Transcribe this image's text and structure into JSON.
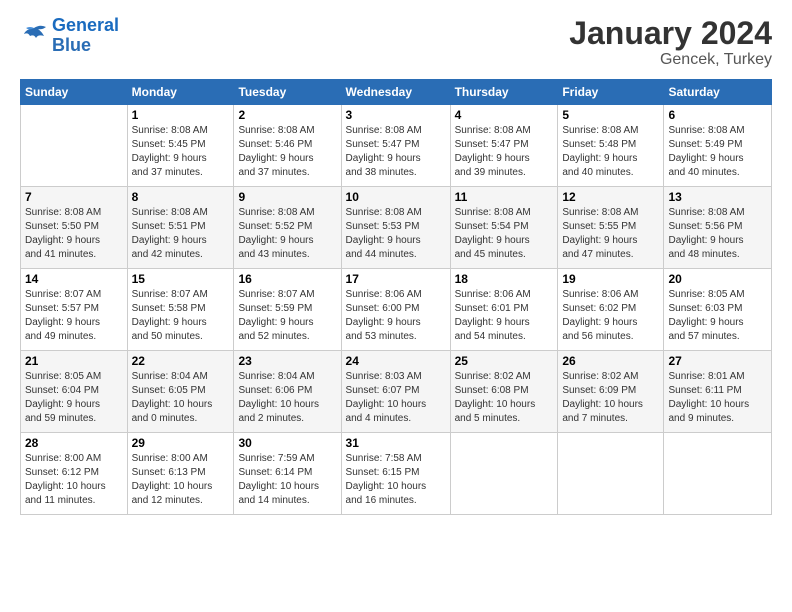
{
  "logo": {
    "line1": "General",
    "line2": "Blue"
  },
  "title": "January 2024",
  "subtitle": "Gencek, Turkey",
  "days_header": [
    "Sunday",
    "Monday",
    "Tuesday",
    "Wednesday",
    "Thursday",
    "Friday",
    "Saturday"
  ],
  "weeks": [
    [
      {
        "day": "",
        "detail": ""
      },
      {
        "day": "1",
        "detail": "Sunrise: 8:08 AM\nSunset: 5:45 PM\nDaylight: 9 hours\nand 37 minutes."
      },
      {
        "day": "2",
        "detail": "Sunrise: 8:08 AM\nSunset: 5:46 PM\nDaylight: 9 hours\nand 37 minutes."
      },
      {
        "day": "3",
        "detail": "Sunrise: 8:08 AM\nSunset: 5:47 PM\nDaylight: 9 hours\nand 38 minutes."
      },
      {
        "day": "4",
        "detail": "Sunrise: 8:08 AM\nSunset: 5:47 PM\nDaylight: 9 hours\nand 39 minutes."
      },
      {
        "day": "5",
        "detail": "Sunrise: 8:08 AM\nSunset: 5:48 PM\nDaylight: 9 hours\nand 40 minutes."
      },
      {
        "day": "6",
        "detail": "Sunrise: 8:08 AM\nSunset: 5:49 PM\nDaylight: 9 hours\nand 40 minutes."
      }
    ],
    [
      {
        "day": "7",
        "detail": "Sunrise: 8:08 AM\nSunset: 5:50 PM\nDaylight: 9 hours\nand 41 minutes."
      },
      {
        "day": "8",
        "detail": "Sunrise: 8:08 AM\nSunset: 5:51 PM\nDaylight: 9 hours\nand 42 minutes."
      },
      {
        "day": "9",
        "detail": "Sunrise: 8:08 AM\nSunset: 5:52 PM\nDaylight: 9 hours\nand 43 minutes."
      },
      {
        "day": "10",
        "detail": "Sunrise: 8:08 AM\nSunset: 5:53 PM\nDaylight: 9 hours\nand 44 minutes."
      },
      {
        "day": "11",
        "detail": "Sunrise: 8:08 AM\nSunset: 5:54 PM\nDaylight: 9 hours\nand 45 minutes."
      },
      {
        "day": "12",
        "detail": "Sunrise: 8:08 AM\nSunset: 5:55 PM\nDaylight: 9 hours\nand 47 minutes."
      },
      {
        "day": "13",
        "detail": "Sunrise: 8:08 AM\nSunset: 5:56 PM\nDaylight: 9 hours\nand 48 minutes."
      }
    ],
    [
      {
        "day": "14",
        "detail": "Sunrise: 8:07 AM\nSunset: 5:57 PM\nDaylight: 9 hours\nand 49 minutes."
      },
      {
        "day": "15",
        "detail": "Sunrise: 8:07 AM\nSunset: 5:58 PM\nDaylight: 9 hours\nand 50 minutes."
      },
      {
        "day": "16",
        "detail": "Sunrise: 8:07 AM\nSunset: 5:59 PM\nDaylight: 9 hours\nand 52 minutes."
      },
      {
        "day": "17",
        "detail": "Sunrise: 8:06 AM\nSunset: 6:00 PM\nDaylight: 9 hours\nand 53 minutes."
      },
      {
        "day": "18",
        "detail": "Sunrise: 8:06 AM\nSunset: 6:01 PM\nDaylight: 9 hours\nand 54 minutes."
      },
      {
        "day": "19",
        "detail": "Sunrise: 8:06 AM\nSunset: 6:02 PM\nDaylight: 9 hours\nand 56 minutes."
      },
      {
        "day": "20",
        "detail": "Sunrise: 8:05 AM\nSunset: 6:03 PM\nDaylight: 9 hours\nand 57 minutes."
      }
    ],
    [
      {
        "day": "21",
        "detail": "Sunrise: 8:05 AM\nSunset: 6:04 PM\nDaylight: 9 hours\nand 59 minutes."
      },
      {
        "day": "22",
        "detail": "Sunrise: 8:04 AM\nSunset: 6:05 PM\nDaylight: 10 hours\nand 0 minutes."
      },
      {
        "day": "23",
        "detail": "Sunrise: 8:04 AM\nSunset: 6:06 PM\nDaylight: 10 hours\nand 2 minutes."
      },
      {
        "day": "24",
        "detail": "Sunrise: 8:03 AM\nSunset: 6:07 PM\nDaylight: 10 hours\nand 4 minutes."
      },
      {
        "day": "25",
        "detail": "Sunrise: 8:02 AM\nSunset: 6:08 PM\nDaylight: 10 hours\nand 5 minutes."
      },
      {
        "day": "26",
        "detail": "Sunrise: 8:02 AM\nSunset: 6:09 PM\nDaylight: 10 hours\nand 7 minutes."
      },
      {
        "day": "27",
        "detail": "Sunrise: 8:01 AM\nSunset: 6:11 PM\nDaylight: 10 hours\nand 9 minutes."
      }
    ],
    [
      {
        "day": "28",
        "detail": "Sunrise: 8:00 AM\nSunset: 6:12 PM\nDaylight: 10 hours\nand 11 minutes."
      },
      {
        "day": "29",
        "detail": "Sunrise: 8:00 AM\nSunset: 6:13 PM\nDaylight: 10 hours\nand 12 minutes."
      },
      {
        "day": "30",
        "detail": "Sunrise: 7:59 AM\nSunset: 6:14 PM\nDaylight: 10 hours\nand 14 minutes."
      },
      {
        "day": "31",
        "detail": "Sunrise: 7:58 AM\nSunset: 6:15 PM\nDaylight: 10 hours\nand 16 minutes."
      },
      {
        "day": "",
        "detail": ""
      },
      {
        "day": "",
        "detail": ""
      },
      {
        "day": "",
        "detail": ""
      }
    ]
  ]
}
